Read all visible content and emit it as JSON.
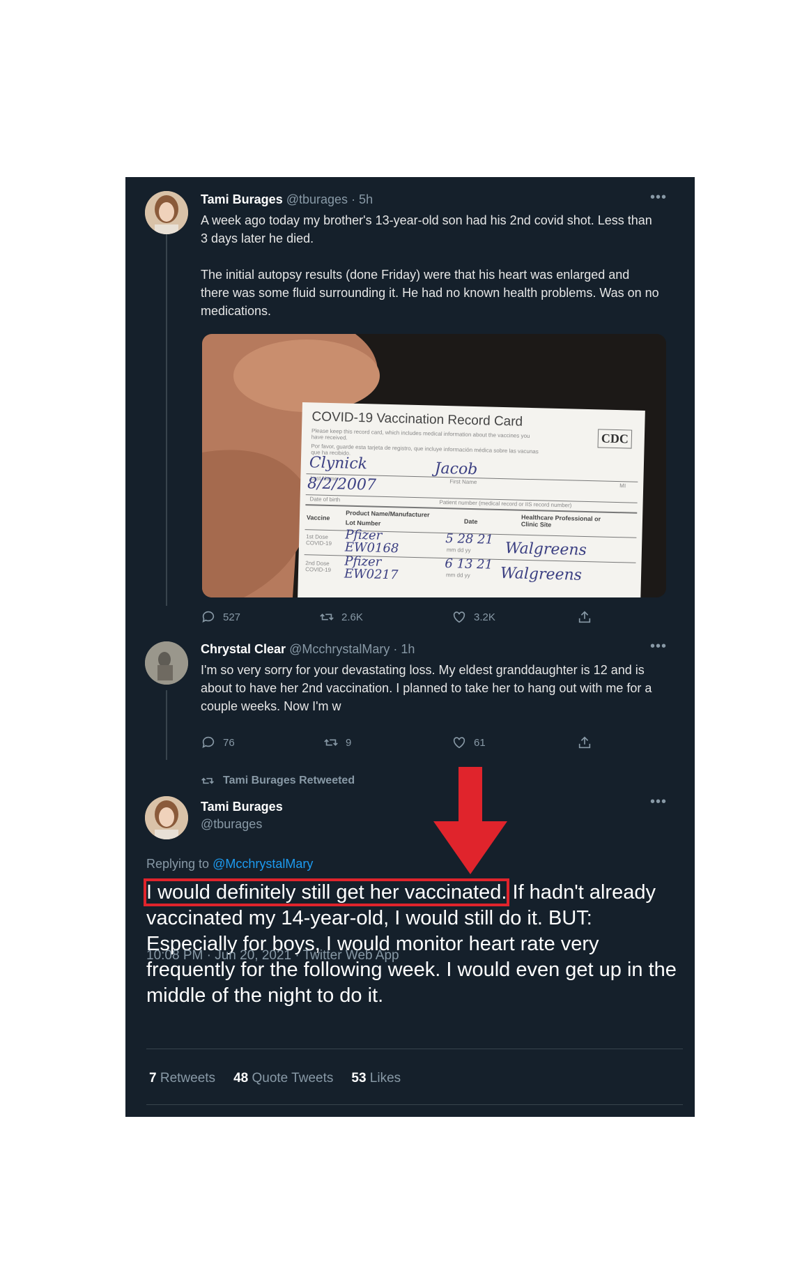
{
  "tweets": [
    {
      "name": "Tami Burages",
      "handle": "@tburages",
      "time": "· 5h",
      "text_p1": "A week ago today my brother's 13-year-old son had his 2nd covid shot. Less than 3 days later he died.",
      "text_p2": "The initial autopsy results (done Friday) were that his heart was enlarged and there was some fluid surrounding it. He had no known health problems. Was on no medications.",
      "counts": {
        "replies": "527",
        "retweets": "2.6K",
        "likes": "3.2K"
      }
    },
    {
      "name": "Chrystal Clear",
      "handle": "@McchrystalMary",
      "time": "· 1h",
      "text": "I'm so very sorry for your devastating loss. My eldest granddaughter is 12 and is about to have her 2nd vaccination. I planned to take her to hang out with me for a couple weeks. Now I'm w",
      "counts": {
        "replies": "76",
        "retweets": "9",
        "likes": "61"
      }
    }
  ],
  "vaccination_card": {
    "title": "COVID-19 Vaccination Record Card",
    "logo": "CDC",
    "fine_en": "Please keep this record card, which includes medical information about the vaccines you have received.",
    "fine_es": "Por favor, guarde esta tarjeta de registro, que incluye información médica sobre las vacunas que ha recibido.",
    "last_name": "Clynick",
    "first_name": "Jacob",
    "last_name_label": "Last Name",
    "first_name_label": "First Name",
    "mi_label": "MI",
    "dob": "8/2/2007",
    "dob_label": "Date of birth",
    "patient_number_label": "Patient number (medical record or IIS record number)",
    "col_vaccine": "Vaccine",
    "col_product": "Product Name/Manufacturer",
    "col_lot": "Lot Number",
    "col_date": "Date",
    "col_site": "Healthcare Professional or Clinic Site",
    "dose1_label": "1st Dose COVID-19",
    "dose2_label": "2nd Dose COVID-19",
    "dose1_product": "Pfizer",
    "dose1_lot": "EW0168",
    "dose1_date": "5 28 21",
    "dose1_site": "Walgreens",
    "dose2_product": "Pfizer",
    "dose2_lot": "EW0217",
    "dose2_date": "6 13 21",
    "dose2_site": "Walgreens",
    "date_hint": "mm dd yy"
  },
  "retweet_banner": "Tami Burages Retweeted",
  "main_tweet": {
    "name": "Tami Burages",
    "handle": "@tburages",
    "replying_prefix": "Replying to",
    "replying_to": "@McchrystalMary",
    "highlighted": "I would definitely still get her vaccinated.",
    "rest": " If hadn't already vaccinated my 14-year-old, I would still do it. BUT: Especially for boys, I would monitor heart rate very frequently for the following week. I would even get up in the middle of the night to do it.",
    "meta": "10:08 PM · Jun 20, 2021 · Twitter Web App",
    "stats": {
      "retweets_count": "7",
      "retweets_label": "Retweets",
      "quotes_count": "48",
      "quotes_label": "Quote Tweets",
      "likes_count": "53",
      "likes_label": "Likes"
    }
  },
  "colors": {
    "background": "#15202b",
    "text_secondary": "#8899a6",
    "link": "#1d9bf0",
    "annotation_red": "#e0242c"
  },
  "icons": [
    "reply-icon",
    "retweet-icon",
    "like-icon",
    "share-icon",
    "more-icon",
    "arrow-down-annotation"
  ]
}
